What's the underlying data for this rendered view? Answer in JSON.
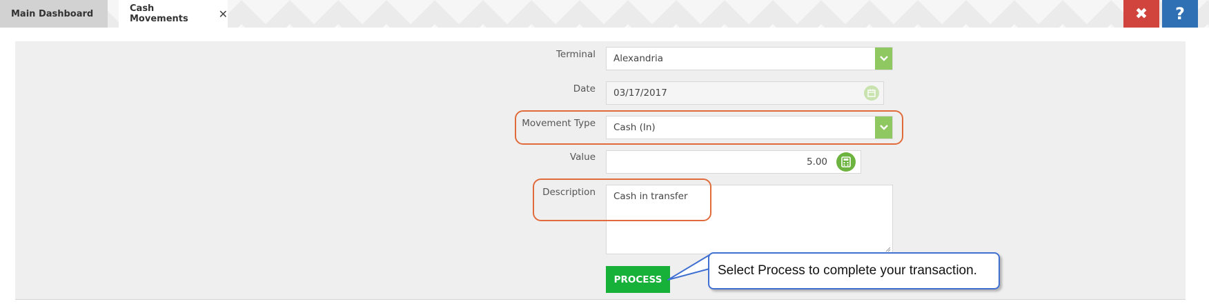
{
  "tabs": [
    {
      "label": "Main Dashboard",
      "active": false
    },
    {
      "label": "Cash Movements",
      "active": true
    }
  ],
  "window_buttons": {
    "close_label": "✖",
    "help_label": "?"
  },
  "form": {
    "terminal": {
      "label": "Terminal",
      "value": "Alexandria"
    },
    "date": {
      "label": "Date",
      "value": "03/17/2017"
    },
    "movement_type": {
      "label": "Movement Type",
      "value": "Cash (In)"
    },
    "value": {
      "label": "Value",
      "value": "5.00"
    },
    "description": {
      "label": "Description",
      "value": "Cash in transfer"
    },
    "process_label": "PROCESS"
  },
  "callout": {
    "text": "Select Process to complete your transaction."
  },
  "icons": {
    "tab_close": "close-icon",
    "dropdown": "chevron-down-icon",
    "date": "calendar-icon",
    "value": "calculator-icon"
  },
  "colors": {
    "dropdown_accent": "#8fc760",
    "process_button": "#17b13a",
    "highlight_outline": "#e06a3a",
    "callout_border": "#3f6fd1",
    "close_button": "#d0443d",
    "help_button": "#2f6fb3"
  }
}
